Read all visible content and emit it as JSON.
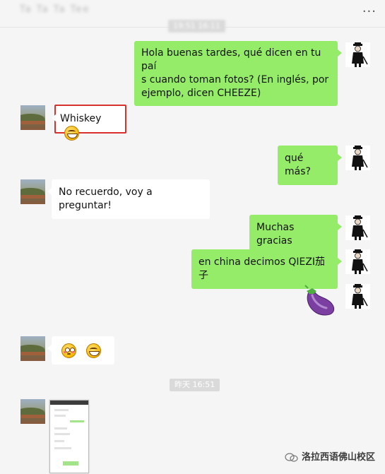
{
  "header": {
    "title": "Ta Ta Ta Tee",
    "more_icon": "more-dots-icon"
  },
  "timestamps": {
    "first": "19:51 16:11",
    "second": "昨天 16:51"
  },
  "messages": {
    "m1": "Hola buenas tardes, qué dicen en tu país cuando toman fotos? (En inglés, por ejemplo, dicen CHEEZE)",
    "m1_line1": "Hola buenas tardes, qué dicen en tu paí",
    "m1_line2": "s cuando toman fotos? (En inglés, por",
    "m1_line3": "ejemplo, dicen CHEEZE)",
    "m2": "Whiskey",
    "m3": "qué más?",
    "m4": "No recuerdo, voy a preguntar!",
    "m5": "Muchas gracias",
    "m6": "en china decimos QIEZI茄子",
    "m7_emoji": "🍆"
  },
  "icons": {
    "grin": "grinning-face-icon",
    "flushed": "flushed-face-icon",
    "eggplant": "eggplant-icon"
  },
  "watermark": {
    "text": "洛拉西语佛山校区"
  },
  "colors": {
    "outgoing": "#95ec69",
    "incoming": "#ffffff",
    "highlight": "#d8302b"
  }
}
